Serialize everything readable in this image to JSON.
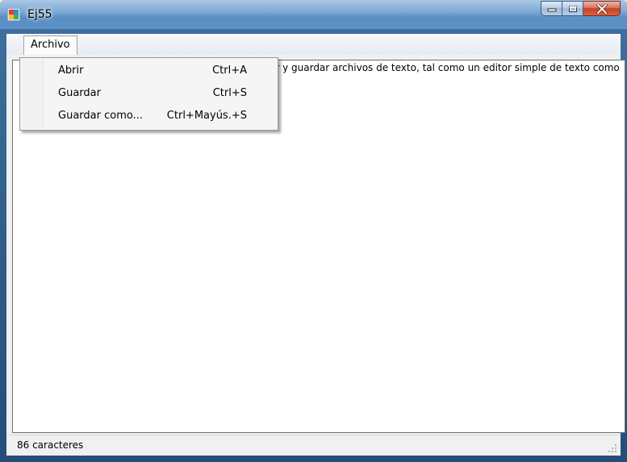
{
  "window": {
    "title": "Ej55"
  },
  "menubar": {
    "archivo_label": "Archivo"
  },
  "menu": {
    "items": [
      {
        "label": "Abrir",
        "shortcut": "Ctrl+A"
      },
      {
        "label": "Guardar",
        "shortcut": "Ctrl+S"
      },
      {
        "label": "Guardar como...",
        "shortcut": "Ctrl+Mayús.+S"
      }
    ]
  },
  "editor": {
    "visible_text_fragment": "ar y guardar archivos de texto, tal como un editor simple de texto como"
  },
  "statusbar": {
    "char_count_label": "86 caracteres"
  },
  "icons": {
    "app": "app-icon",
    "minimize": "minimize-icon",
    "maximize": "maximize-icon",
    "close": "close-icon",
    "grip": "resize-grip-icon"
  },
  "colors": {
    "titlebar": "#5c90c6",
    "close_button": "#c2452b",
    "client_background": "#f0f0f0",
    "editor_background": "#ffffff"
  }
}
